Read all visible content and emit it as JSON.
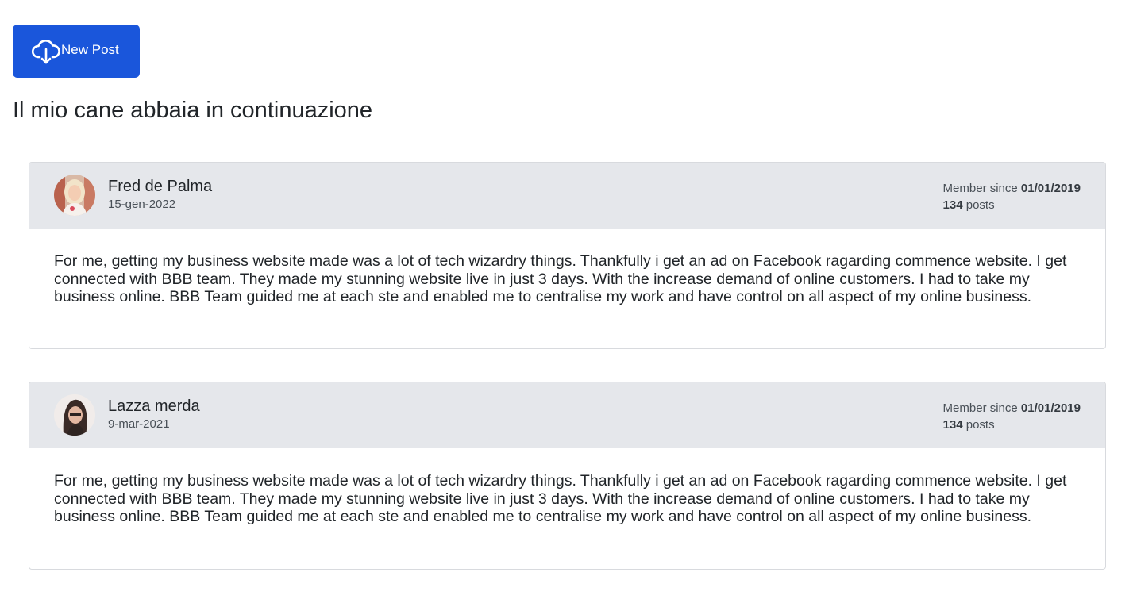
{
  "toolbar": {
    "new_post_label": "New Post",
    "new_post_icon": "cloud-download-icon"
  },
  "thread": {
    "title": "Il mio cane abbaia in continuazione"
  },
  "posts": [
    {
      "author": "Fred de Palma",
      "date": "15-gen-2022",
      "member_since_label": "Member since",
      "member_since": "01/01/2019",
      "post_count": "134",
      "posts_label": "posts",
      "body": "For me, getting my business website made was a lot of tech wizardry things. Thankfully i get an ad on Facebook ragarding commence website. I get connected with BBB team. They made my stunning website live in just 3 days. With the increase demand of online customers. I had to take my business online. BBB Team guided me at each ste and enabled me to centralise my work and have control on all aspect of my online business."
    },
    {
      "author": "Lazza merda",
      "date": "9-mar-2021",
      "member_since_label": "Member since",
      "member_since": "01/01/2019",
      "post_count": "134",
      "posts_label": "posts",
      "body": "For me, getting my business website made was a lot of tech wizardry things. Thankfully i get an ad on Facebook ragarding commence website. I get connected with BBB team. They made my stunning website live in just 3 days. With the increase demand of online customers. I had to take my business online. BBB Team guided me at each ste and enabled me to centralise my work and have control on all aspect of my online business."
    }
  ],
  "colors": {
    "accent": "#1a56db",
    "header_bg": "#e5e7eb"
  }
}
